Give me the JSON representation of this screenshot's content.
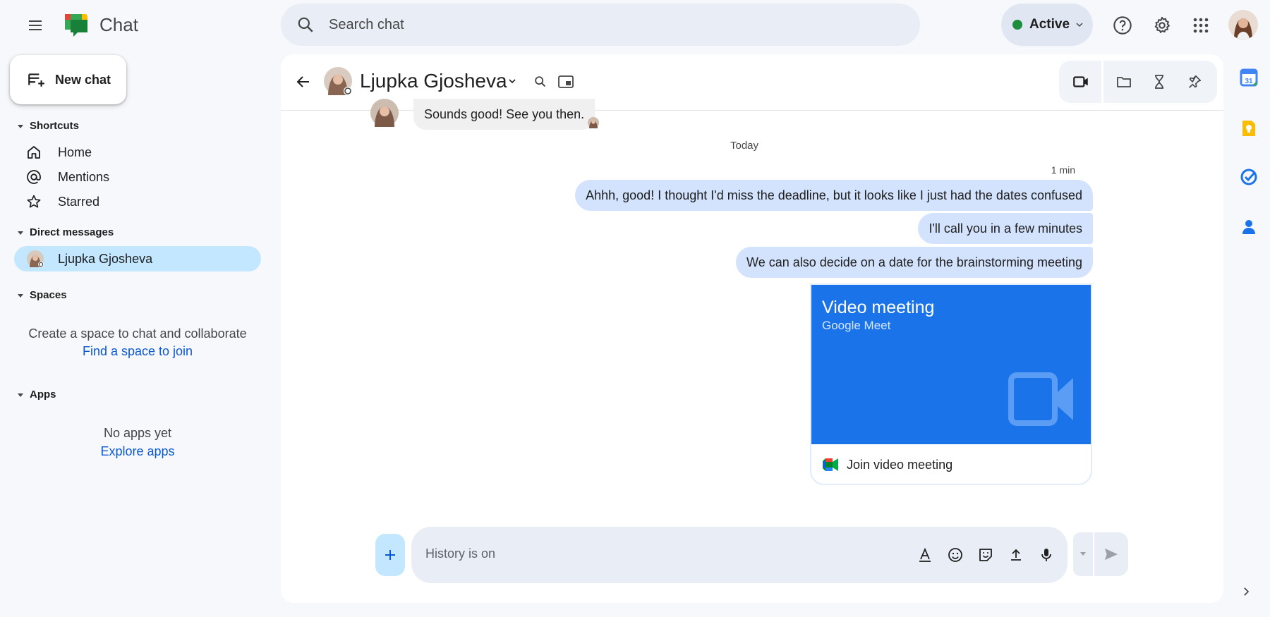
{
  "app": {
    "name": "Chat"
  },
  "search": {
    "placeholder": "Search chat"
  },
  "status": {
    "label": "Active",
    "color": "#1e8e3e"
  },
  "sidebar": {
    "new_chat_label": "New chat",
    "sections": {
      "shortcuts": "Shortcuts",
      "direct_messages": "Direct messages",
      "spaces": "Spaces",
      "apps": "Apps"
    },
    "shortcuts": [
      {
        "label": "Home",
        "icon": "home-icon"
      },
      {
        "label": "Mentions",
        "icon": "at-icon"
      },
      {
        "label": "Starred",
        "icon": "star-icon"
      }
    ],
    "dm_items": [
      {
        "label": "Ljupka Gjosheva",
        "selected": true
      }
    ],
    "spaces_text": "Create a space to chat and collaborate",
    "spaces_link": "Find a space to join",
    "apps_text": "No apps yet",
    "apps_link": "Explore apps"
  },
  "conversation": {
    "name": "Ljupka Gjosheva",
    "previous_message": "Sounds good! See you then.",
    "day_divider": "Today",
    "timestamp": "1 min",
    "messages": [
      "Ahhh, good! I thought I'd miss the deadline, but it looks like I just had the dates confused",
      "I'll call you in a few minutes",
      "We can also decide on a date for the brainstorming meeting"
    ],
    "card": {
      "title": "Video meeting",
      "subtitle": "Google Meet",
      "action": "Join video meeting"
    }
  },
  "composer": {
    "placeholder": "History is on"
  },
  "colors": {
    "accent": "#0b57d0",
    "selected": "#c2e7ff",
    "bubble_sent": "#d3e3fd",
    "meet_blue": "#1a73e8"
  }
}
